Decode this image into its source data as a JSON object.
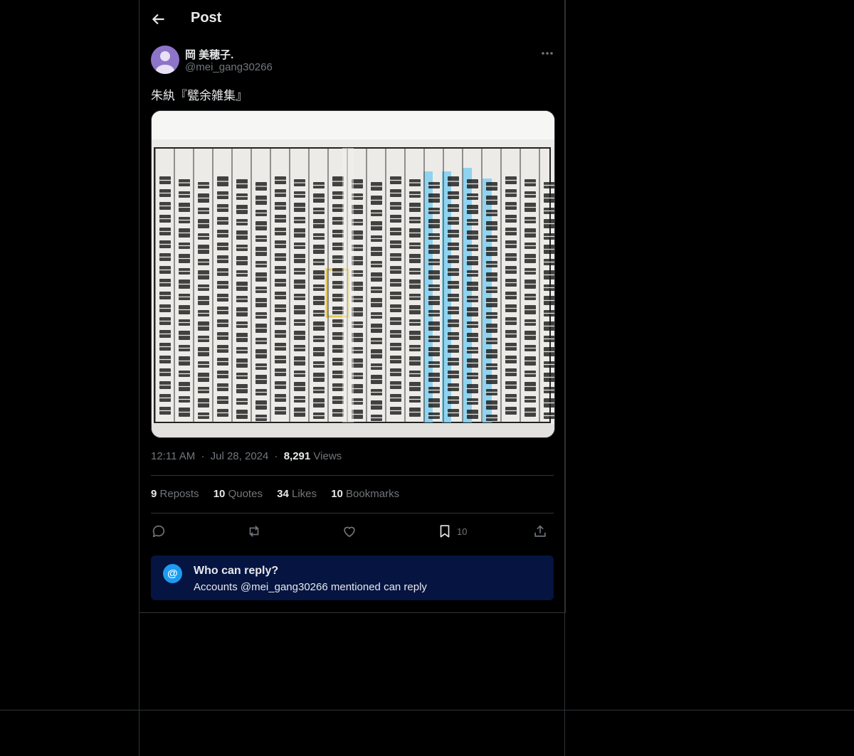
{
  "header": {
    "title": "Post"
  },
  "post": {
    "author_name": "岡 美穂子.",
    "author_handle": "@mei_gang30266",
    "text": "朱紈『甓余雑集』",
    "time": "12:11 AM",
    "date": "Jul 28, 2024",
    "views_count": "8,291",
    "views_label": "Views",
    "separator": "·"
  },
  "stats": {
    "reposts_count": "9",
    "reposts_label": "Reposts",
    "quotes_count": "10",
    "quotes_label": "Quotes",
    "likes_count": "34",
    "likes_label": "Likes",
    "bookmarks_count": "10",
    "bookmarks_label": "Bookmarks"
  },
  "actions": {
    "bookmark_count": "10",
    "icons": [
      "reply-icon",
      "repost-icon",
      "like-icon",
      "bookmark-icon",
      "share-icon"
    ]
  },
  "reply_settings": {
    "title": "Who can reply?",
    "subtitle": "Accounts @mei_gang30266 mentioned can reply",
    "icon_glyph": "@"
  },
  "colors": {
    "background": "#000000",
    "border": "#2f3336",
    "muted": "#71767b",
    "text": "#e7e9ea",
    "accent": "#1d9bf0",
    "reply_box": "#051441",
    "avatar": "#8e74c9"
  }
}
